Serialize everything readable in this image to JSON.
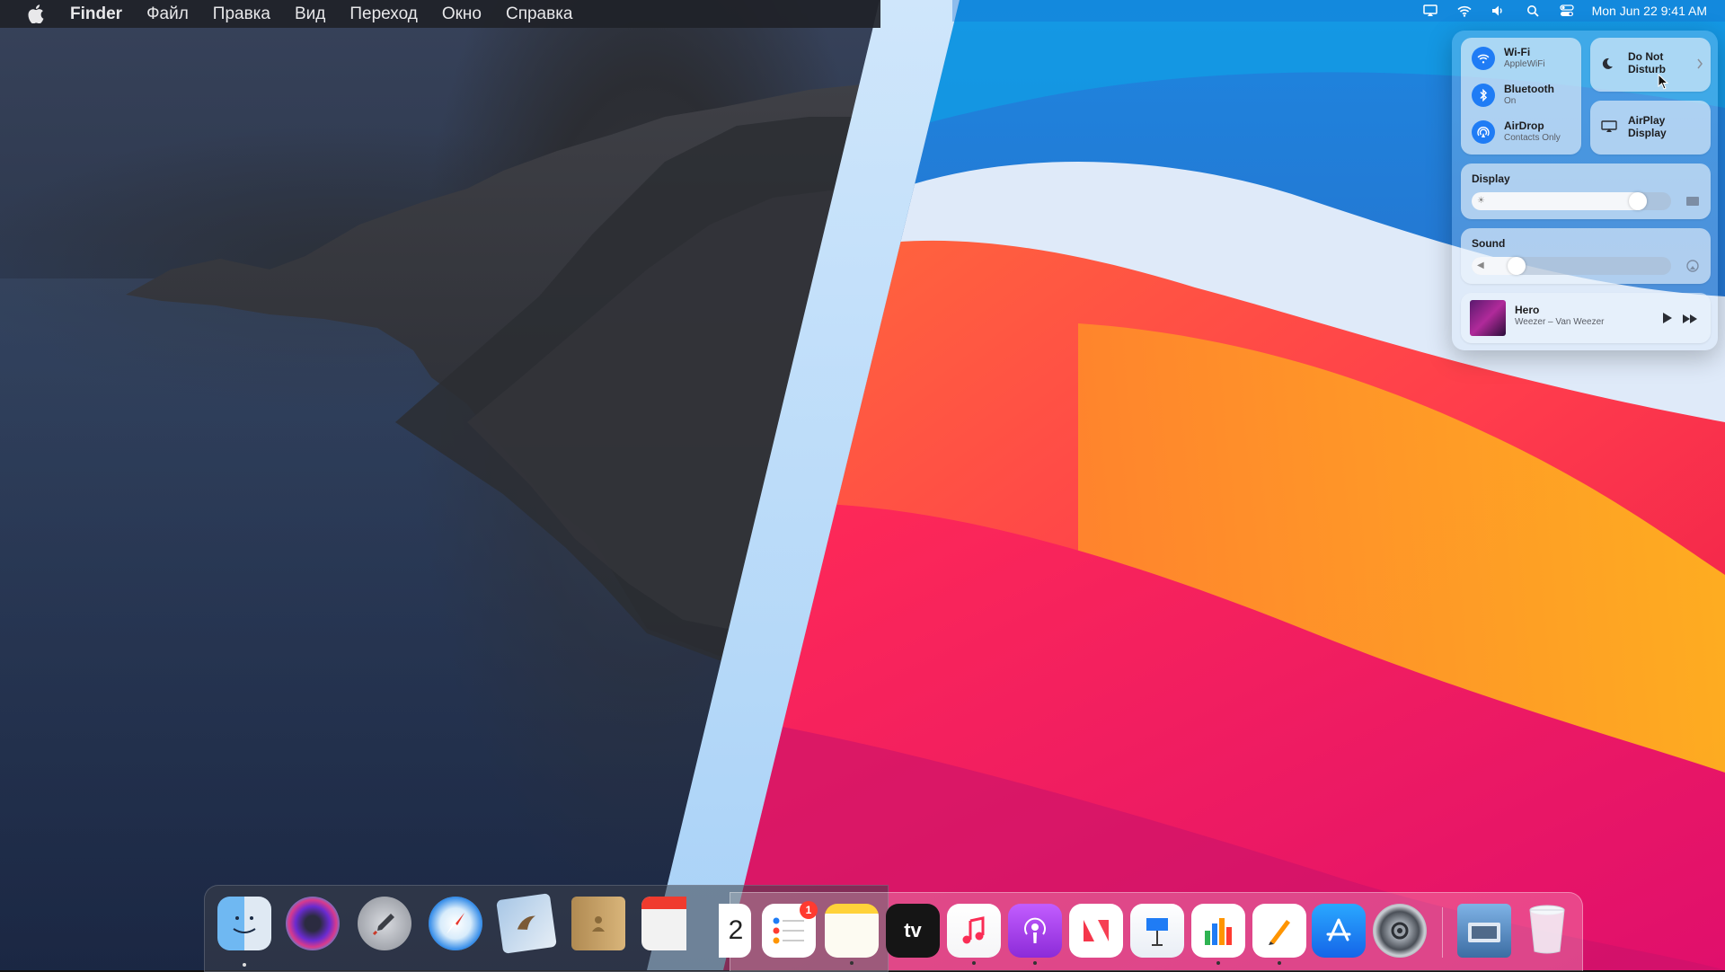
{
  "menubar": {
    "app_name": "Finder",
    "items": [
      "Файл",
      "Правка",
      "Вид",
      "Переход",
      "Окно",
      "Справка"
    ]
  },
  "status_bar": {
    "clock": "Mon Jun 22  9:41 AM",
    "icons": [
      "airplay-icon",
      "wifi-icon",
      "volume-icon",
      "search-icon",
      "control-center-icon"
    ]
  },
  "control_center": {
    "wifi": {
      "title": "Wi-Fi",
      "subtitle": "AppleWiFi"
    },
    "bluetooth": {
      "title": "Bluetooth",
      "subtitle": "On"
    },
    "airdrop": {
      "title": "AirDrop",
      "subtitle": "Contacts Only"
    },
    "do_not_disturb": {
      "title_line1": "Do Not",
      "title_line2": "Disturb"
    },
    "airplay_display": {
      "title_line1": "AirPlay",
      "title_line2": "Display"
    },
    "display": {
      "label": "Display",
      "level": 0.88
    },
    "sound": {
      "label": "Sound",
      "level": 0.27
    },
    "now_playing": {
      "title": "Hero",
      "artist": "Weezer – Van Weezer"
    }
  },
  "dock": {
    "badge_reminders": "1",
    "calendar_day": "2"
  },
  "colors": {
    "accent_blue": "#1f7cf5",
    "badge_red": "#ff3b30"
  }
}
